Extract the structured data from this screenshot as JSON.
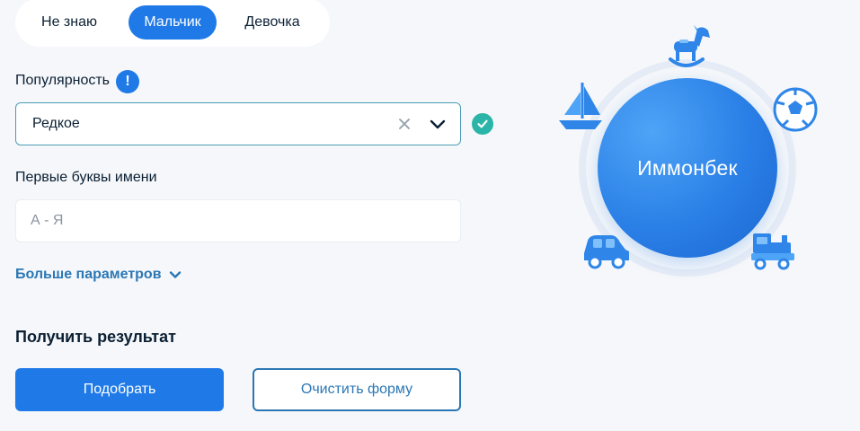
{
  "gender": {
    "options": [
      "Не знаю",
      "Мальчик",
      "Девочка"
    ],
    "selected": "Мальчик"
  },
  "popularity": {
    "label": "Популярность",
    "info_badge": "!",
    "value": "Редкое"
  },
  "first_letters": {
    "label": "Первые буквы имени",
    "placeholder": "А - Я"
  },
  "more_params": {
    "label": "Больше параметров"
  },
  "result": {
    "heading": "Получить результат",
    "submit_label": "Подобрать",
    "clear_label": "Очистить форму"
  },
  "illustration": {
    "name": "Иммонбек",
    "toys": [
      "rocking-horse-icon",
      "sailboat-icon",
      "soccer-ball-icon",
      "toy-car-icon",
      "toy-train-icon"
    ]
  },
  "colors": {
    "accent": "#1f7ae8",
    "link": "#2b77b4",
    "valid": "#2bb5a8",
    "bubble": "#2a7fe6"
  }
}
